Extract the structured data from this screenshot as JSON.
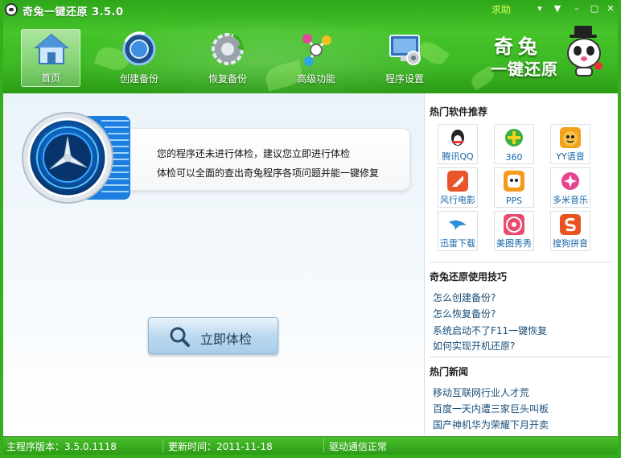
{
  "window": {
    "title": "奇兔一键还原 3.5.0",
    "help": "求助",
    "controls": [
      "▾",
      "▼",
      "–",
      "▢",
      "✕"
    ]
  },
  "toolbar": [
    {
      "label": "首页",
      "icon": "home-icon"
    },
    {
      "label": "创建备份",
      "icon": "create-backup-icon"
    },
    {
      "label": "恢复备份",
      "icon": "restore-backup-icon"
    },
    {
      "label": "高级功能",
      "icon": "advanced-icon"
    },
    {
      "label": "程序设置",
      "icon": "settings-icon"
    }
  ],
  "brand": {
    "line1": "奇兔",
    "line2": "一键还原"
  },
  "main": {
    "message1": "您的程序还未进行体检，建议您立即进行体检",
    "message2": "体检可以全面的查出奇兔程序各项问题并能一键修复",
    "check_button": "立即体检"
  },
  "side": {
    "hot_apps_title": "热门软件推荐",
    "apps": [
      {
        "name": "腾讯QQ",
        "color": "#222222"
      },
      {
        "name": "360",
        "color": "#3cb043"
      },
      {
        "name": "YY语音",
        "color": "#f2a31a"
      },
      {
        "name": "风行电影",
        "color": "#e8552a"
      },
      {
        "name": "PPS",
        "color": "#f49a1c"
      },
      {
        "name": "多米音乐",
        "color": "#e84393"
      },
      {
        "name": "迅雷下载",
        "color": "#2b8fd6"
      },
      {
        "name": "美图秀秀",
        "color": "#e94c6f"
      },
      {
        "name": "搜狗拼音",
        "color": "#e8531f"
      }
    ],
    "tips_title": "奇兔还原使用技巧",
    "tips": [
      "怎么创建备份?",
      "怎么恢复备份?",
      "系统启动不了F11一键恢复",
      "如何实现开机还原?"
    ],
    "news_title": "热门新闻",
    "news": [
      "移动互联网行业人才荒",
      "百度一天内遭三家巨头叫板",
      "国产神机华为荣耀下月开卖"
    ]
  },
  "status": {
    "version": "主程序版本：3.5.0.1118",
    "update": "更新时间：2011-11-18",
    "driver": "驱动通信正常"
  }
}
